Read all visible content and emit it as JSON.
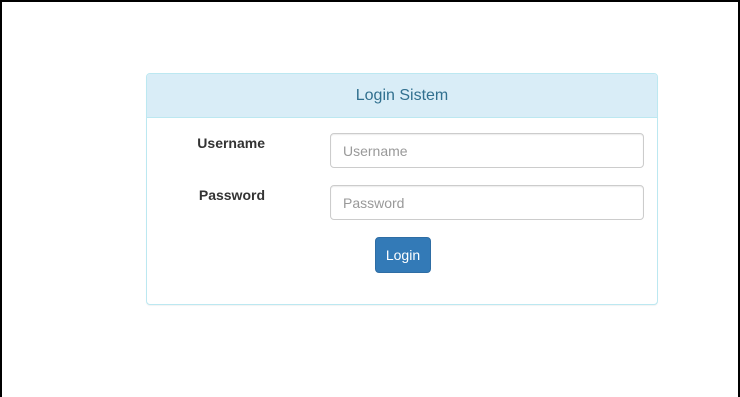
{
  "panel": {
    "title": "Login Sistem"
  },
  "form": {
    "username_label": "Username",
    "username_placeholder": "Username",
    "username_value": "",
    "password_label": "Password",
    "password_placeholder": "Password",
    "password_value": "",
    "login_label": "Login"
  },
  "colors": {
    "heading_bg": "#d9edf7",
    "heading_text": "#31708f",
    "panel_border": "#bce8f1",
    "button_bg": "#337ab7"
  }
}
